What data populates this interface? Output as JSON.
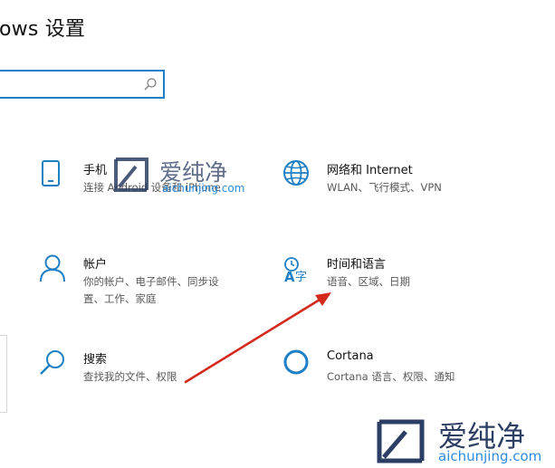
{
  "header": {
    "title": "ows 设置"
  },
  "search": {
    "placeholder": ""
  },
  "tiles": {
    "phone": {
      "name": "手机",
      "desc": "连接 Android 设备和 iPhone"
    },
    "network": {
      "name": "网络和 Internet",
      "desc": "WLAN、飞行模式、VPN"
    },
    "accounts": {
      "name": "帐户",
      "desc": "你的帐户、电子邮件、同步设置、工作、家庭"
    },
    "time": {
      "name": "时间和语言",
      "desc": "语音、区域、日期"
    },
    "search": {
      "name": "搜索",
      "desc": "查找我的文件、权限"
    },
    "cortana": {
      "name": "Cortana",
      "desc": "Cortana 语言、权限、通知"
    }
  },
  "watermark": {
    "brand": "爱纯净",
    "url": "aichunjing.com"
  },
  "colors": {
    "accent": "#1f7fc4",
    "arrow": "#d42a1e",
    "watermark_dark": "#2c3e63",
    "watermark_blue": "#2d8be0"
  },
  "icons": {
    "phone": "phone-icon",
    "network": "globe-icon",
    "accounts": "person-icon",
    "time": "time-language-icon",
    "search": "magnifier-icon",
    "cortana": "cortana-ring-icon"
  }
}
